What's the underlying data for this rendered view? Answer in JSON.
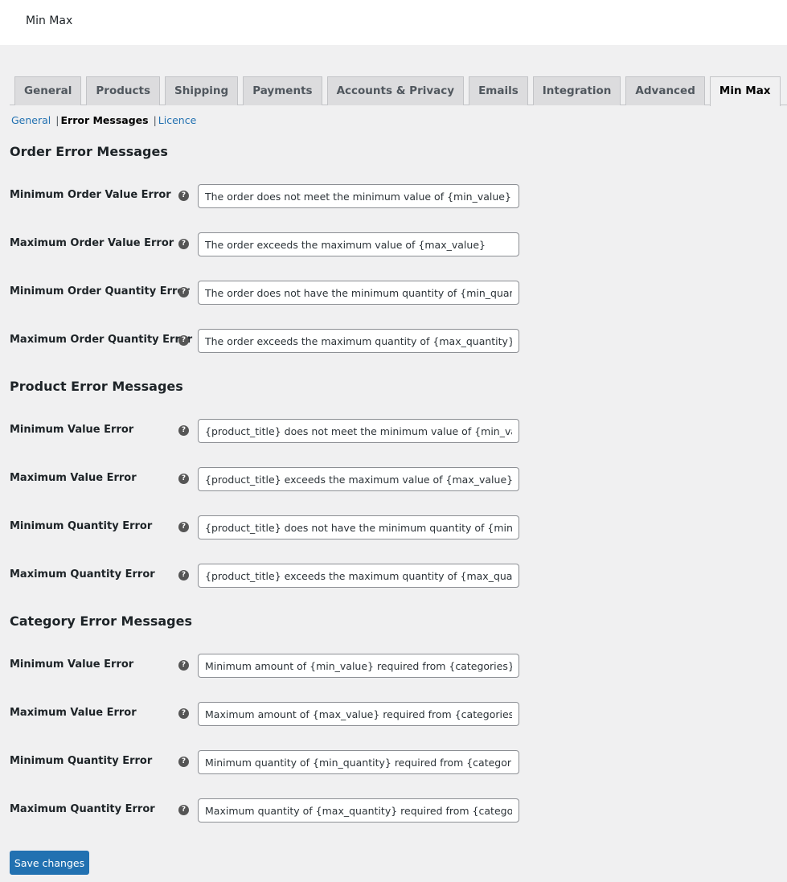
{
  "header": {
    "title": "Min Max"
  },
  "tabs": [
    {
      "label": "General",
      "active": false
    },
    {
      "label": "Products",
      "active": false
    },
    {
      "label": "Shipping",
      "active": false
    },
    {
      "label": "Payments",
      "active": false
    },
    {
      "label": "Accounts & Privacy",
      "active": false
    },
    {
      "label": "Emails",
      "active": false
    },
    {
      "label": "Integration",
      "active": false
    },
    {
      "label": "Advanced",
      "active": false
    },
    {
      "label": "Min Max",
      "active": true
    }
  ],
  "subnav": {
    "items": [
      {
        "label": "General",
        "current": false
      },
      {
        "label": "Error Messages",
        "current": true
      },
      {
        "label": "Licence",
        "current": false
      }
    ],
    "separator": "|"
  },
  "sections": [
    {
      "title": "Order Error Messages",
      "fields": [
        {
          "label": "Minimum Order Value Error",
          "value": "The order does not meet the minimum value of {min_value}"
        },
        {
          "label": "Maximum Order Value Error",
          "value": "The order exceeds the maximum value of {max_value}"
        },
        {
          "label": "Minimum Order Quantity Error",
          "value": "The order does not have the minimum quantity of {min_quant"
        },
        {
          "label": "Maximum Order Quantity Error",
          "value": "The order exceeds the maximum quantity of {max_quantity}"
        }
      ]
    },
    {
      "title": "Product Error Messages",
      "fields": [
        {
          "label": "Minimum Value Error",
          "value": "{product_title} does not meet the minimum value of {min_valu"
        },
        {
          "label": "Maximum Value Error",
          "value": "{product_title} exceeds the maximum value of {max_value}"
        },
        {
          "label": "Minimum Quantity Error",
          "value": "{product_title} does not have the minimum quantity of {min_q"
        },
        {
          "label": "Maximum Quantity Error",
          "value": "{product_title} exceeds the maximum quantity of {max_quantit"
        }
      ]
    },
    {
      "title": "Category Error Messages",
      "fields": [
        {
          "label": "Minimum Value Error",
          "value": "Minimum amount of {min_value} required from {categories}"
        },
        {
          "label": "Maximum Value Error",
          "value": "Maximum amount of {max_value} required from {categories}"
        },
        {
          "label": "Minimum Quantity Error",
          "value": "Minimum quantity of {min_quantity} required from {categories"
        },
        {
          "label": "Maximum Quantity Error",
          "value": "Maximum quantity of {max_quantity} required from {categorie"
        }
      ]
    }
  ],
  "help_icon": {
    "name": "help-icon",
    "glyph": "?"
  },
  "footer": {
    "save_label": "Save changes"
  },
  "colors": {
    "accent": "#2271b1",
    "background": "#f0f0f1",
    "tab_inactive": "#dcdcde"
  }
}
